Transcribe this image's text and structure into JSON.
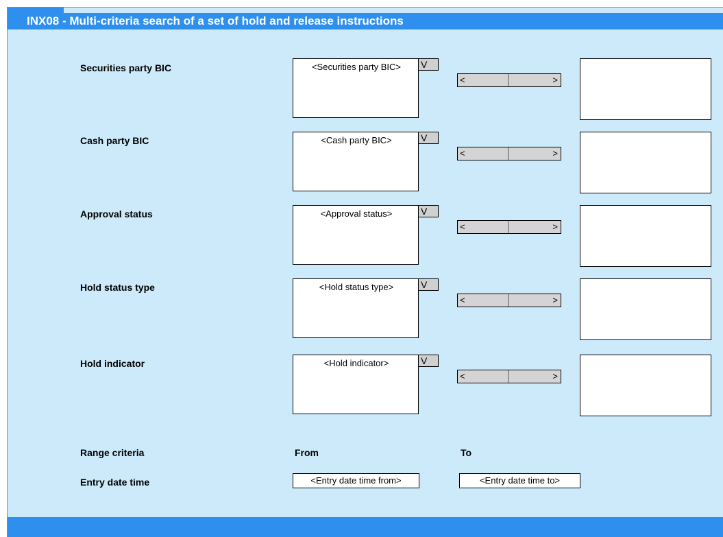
{
  "window": {
    "title": "INX08 - Multi-criteria search of a set of hold and release instructions"
  },
  "criteria": [
    {
      "label": "Securities party BIC",
      "placeholder": "<Securities party BIC>",
      "dropdown": "V",
      "move_left": "<",
      "move_right": ">"
    },
    {
      "label": "Cash party BIC",
      "placeholder": "<Cash party BIC>",
      "dropdown": "V",
      "move_left": "<",
      "move_right": ">"
    },
    {
      "label": "Approval status",
      "placeholder": "<Approval status>",
      "dropdown": "V",
      "move_left": "<",
      "move_right": ">"
    },
    {
      "label": "Hold status type",
      "placeholder": "<Hold status type>",
      "dropdown": "V",
      "move_left": "<",
      "move_right": ">"
    },
    {
      "label": "Hold indicator",
      "placeholder": "<Hold indicator>",
      "dropdown": "V",
      "move_left": "<",
      "move_right": ">"
    }
  ],
  "range": {
    "label": "Range criteria",
    "from_label": "From",
    "to_label": "To",
    "entry": {
      "label": "Entry date time",
      "from_value": "<Entry date time from>",
      "to_value": "<Entry date time to>"
    }
  }
}
